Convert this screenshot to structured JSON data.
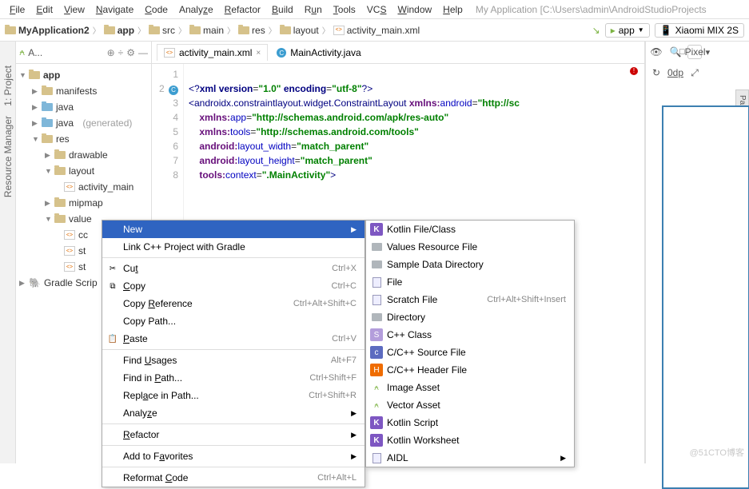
{
  "menubar": {
    "items": [
      "File",
      "Edit",
      "View",
      "Navigate",
      "Code",
      "Analyze",
      "Refactor",
      "Build",
      "Run",
      "Tools",
      "VCS",
      "Window",
      "Help"
    ],
    "app_info": "My Application [C:\\Users\\admin\\AndroidStudioProjects"
  },
  "breadcrumb": {
    "items": [
      "MyApplication2",
      "app",
      "src",
      "main",
      "res",
      "layout",
      "activity_main.xml"
    ]
  },
  "toolbar": {
    "run_config": "app",
    "device": "Xiaomi MIX 2S"
  },
  "left_rail": {
    "labels": [
      "1: Project",
      "Resource Manager"
    ]
  },
  "project_tree": {
    "root": "app",
    "children": [
      {
        "icon": "folder",
        "label": "manifests"
      },
      {
        "icon": "folder-blue",
        "label": "java"
      },
      {
        "icon": "folder-blue",
        "label": "java",
        "suffix": "(generated)"
      },
      {
        "icon": "folder",
        "label": "res",
        "expanded": true,
        "children": [
          {
            "icon": "folder",
            "label": "drawable"
          },
          {
            "icon": "folder",
            "label": "layout",
            "expanded": true,
            "children": [
              {
                "icon": "xml",
                "label": "activity_main"
              }
            ]
          },
          {
            "icon": "folder",
            "label": "mipmap"
          },
          {
            "icon": "folder",
            "label": "value",
            "expanded": true,
            "children": [
              {
                "icon": "xml",
                "label": "cc"
              },
              {
                "icon": "xml",
                "label": "st"
              },
              {
                "icon": "xml",
                "label": "st"
              }
            ]
          }
        ]
      }
    ],
    "gradle": "Gradle Scrip"
  },
  "tabs": {
    "items": [
      {
        "icon": "xml",
        "label": "activity_main.xml",
        "active": true
      },
      {
        "icon": "class",
        "label": "MainActivity.java",
        "active": false
      }
    ]
  },
  "code": {
    "lines": [
      "<?xml version=\"1.0\" encoding=\"utf-8\"?>",
      "<androidx.constraintlayout.widget.ConstraintLayout xmlns:android=\"http://sc",
      "    xmlns:app=\"http://schemas.android.com/apk/res-auto\"",
      "    xmlns:tools=\"http://schemas.android.com/tools\"",
      "    android:layout_width=\"match_parent\"",
      "    android:layout_height=\"match_parent\"",
      "    tools:context=\".MainActivity\">",
      ""
    ]
  },
  "design_toolbar": {
    "device": "Pixel",
    "zoom": "0dp"
  },
  "context_menu": {
    "items": [
      {
        "label": "New",
        "hover": true,
        "submenu": true
      },
      {
        "label": "Link C++ Project with Gradle"
      },
      {
        "sep": true
      },
      {
        "icon": "cut",
        "label": "Cut",
        "shortcut": "Ctrl+X"
      },
      {
        "icon": "copy",
        "label": "Copy",
        "shortcut": "Ctrl+C"
      },
      {
        "label": "Copy Reference",
        "shortcut": "Ctrl+Alt+Shift+C"
      },
      {
        "label": "Copy Path..."
      },
      {
        "icon": "paste",
        "label": "Paste",
        "shortcut": "Ctrl+V"
      },
      {
        "sep": true
      },
      {
        "label": "Find Usages",
        "shortcut": "Alt+F7"
      },
      {
        "label": "Find in Path...",
        "shortcut": "Ctrl+Shift+F"
      },
      {
        "label": "Replace in Path...",
        "shortcut": "Ctrl+Shift+R"
      },
      {
        "label": "Analyze",
        "submenu": true
      },
      {
        "sep": true
      },
      {
        "label": "Refactor",
        "submenu": true
      },
      {
        "sep": true
      },
      {
        "label": "Add to Favorites",
        "submenu": true
      },
      {
        "sep": true
      },
      {
        "label": "Reformat Code",
        "shortcut": "Ctrl+Alt+L"
      }
    ]
  },
  "submenu": {
    "items": [
      {
        "icon": "k",
        "label": "Kotlin File/Class"
      },
      {
        "icon": "folder",
        "label": "Values Resource File"
      },
      {
        "icon": "folder",
        "label": "Sample Data Directory"
      },
      {
        "icon": "file",
        "label": "File"
      },
      {
        "icon": "file",
        "label": "Scratch File",
        "shortcut": "Ctrl+Alt+Shift+Insert"
      },
      {
        "icon": "folder",
        "label": "Directory"
      },
      {
        "icon": "s",
        "label": "C++ Class"
      },
      {
        "icon": "c",
        "label": "C/C++ Source File"
      },
      {
        "icon": "h",
        "label": "C/C++ Header File"
      },
      {
        "icon": "android",
        "label": "Image Asset"
      },
      {
        "icon": "android",
        "label": "Vector Asset"
      },
      {
        "icon": "k",
        "label": "Kotlin Script"
      },
      {
        "icon": "k",
        "label": "Kotlin Worksheet"
      },
      {
        "icon": "file",
        "label": "AIDL",
        "submenu": true
      }
    ]
  },
  "watermark": "@51CTO博客"
}
